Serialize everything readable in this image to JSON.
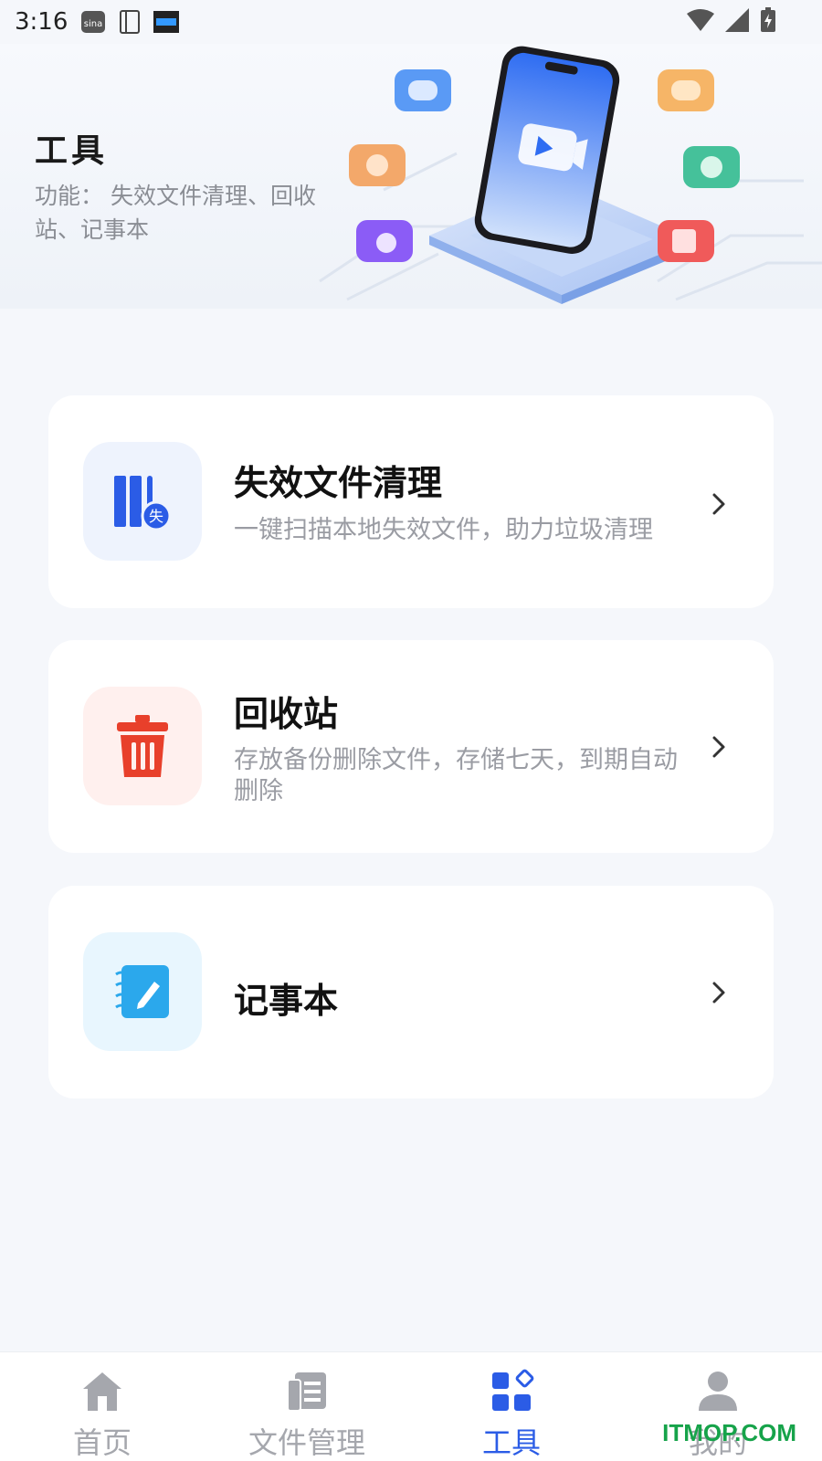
{
  "status_bar": {
    "time": "3:16"
  },
  "header": {
    "title": "工具",
    "description": "功能： 失效文件清理、回收站、记事本"
  },
  "cards": [
    {
      "title": "失效文件清理",
      "desc": "一键扫描本地失效文件，助力垃圾清理",
      "icon": "invalid-files-icon",
      "icon_bg": "#eef3fd"
    },
    {
      "title": "回收站",
      "desc": "存放备份删除文件，存储七天，到期自动删除",
      "icon": "trash-icon",
      "icon_bg": "#fff0ee"
    },
    {
      "title": "记事本",
      "desc": "",
      "icon": "notebook-icon",
      "icon_bg": "#e8f6fe"
    }
  ],
  "nav": [
    {
      "label": "首页",
      "icon": "home-icon",
      "active": false
    },
    {
      "label": "文件管理",
      "icon": "file-manager-icon",
      "active": false
    },
    {
      "label": "工具",
      "icon": "tools-icon",
      "active": true
    },
    {
      "label": "我的",
      "icon": "profile-icon",
      "active": false
    }
  ],
  "watermark": "ITMOP.COM",
  "colors": {
    "accent": "#2b5ce6",
    "inactive": "#a5a7ad",
    "danger": "#e8402b",
    "info": "#2ba8ec"
  }
}
